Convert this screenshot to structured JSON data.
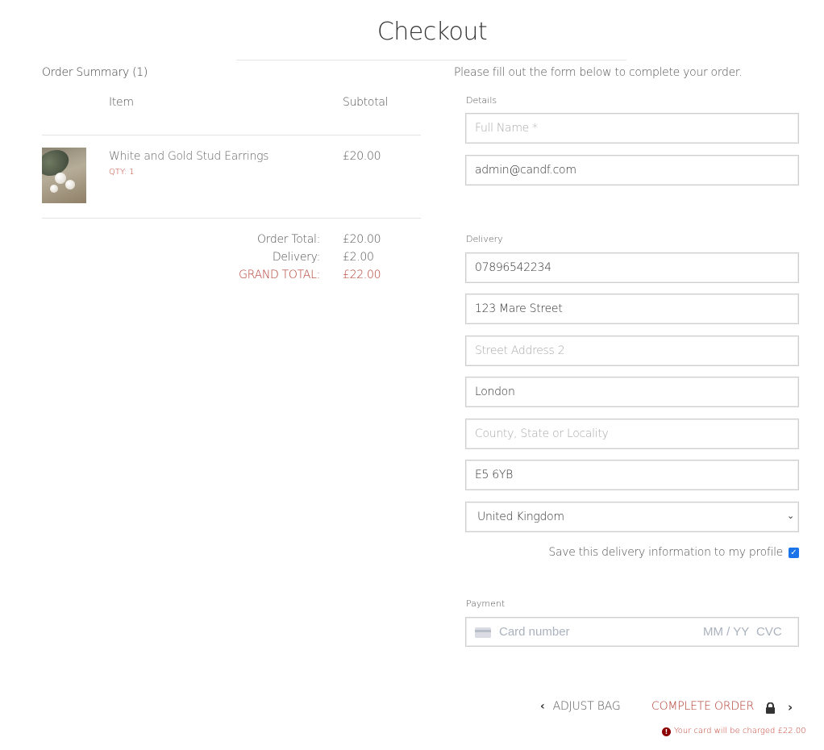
{
  "page": {
    "title": "Checkout"
  },
  "summary": {
    "heading": "Order Summary (1)",
    "col_item": "Item",
    "col_subtotal": "Subtotal",
    "items": [
      {
        "name": "White and Gold Stud Earrings",
        "qty": "QTY: 1",
        "price": "£20.00"
      }
    ],
    "order_total_label": "Order Total:",
    "order_total": "£20.00",
    "delivery_label": "Delivery:",
    "delivery": "£2.00",
    "grand_total_label": "GRAND TOTAL:",
    "grand_total": "£22.00"
  },
  "form": {
    "intro": "Please fill out the form below to complete your order.",
    "details_label": "Details",
    "full_name_placeholder": "Full Name *",
    "email_value": "admin@candf.com",
    "delivery_label": "Delivery",
    "phone_value": "07896542234",
    "street1_value": "123 Mare Street",
    "street2_placeholder": "Street Address 2",
    "town_value": "London",
    "county_placeholder": "County, State or Locality",
    "postcode_value": "E5 6YB",
    "country_selected": "United Kingdom",
    "save_label": "Save this delivery information to my profile",
    "save_checked": true,
    "payment_label": "Payment",
    "card_number_placeholder": "Card number",
    "card_exp_placeholder": "MM / YY",
    "card_cvc_placeholder": "CVC"
  },
  "actions": {
    "adjust_bag": "ADJUST BAG",
    "complete_order": "COMPLETE ORDER",
    "charge_note": "Your card will be charged £22.00"
  },
  "colors": {
    "accent": "#b03a2e",
    "alert": "#8b0000"
  }
}
